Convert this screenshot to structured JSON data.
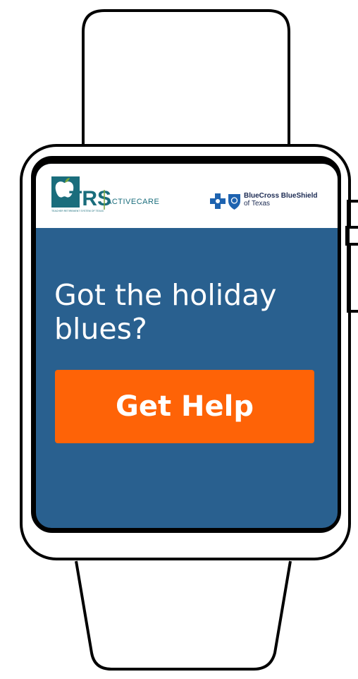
{
  "brand": {
    "trs_initials": "TRS",
    "trs_tagline": "TEACHER RETIREMENT SYSTEM OF TEXAS",
    "program_name": "ACTIVECARE",
    "insurer_name": "BlueCross BlueShield",
    "insurer_region": "of Texas"
  },
  "main": {
    "headline": "Got the holiday blues?",
    "cta_label": "Get Help"
  },
  "colors": {
    "screen_background": "#29608f",
    "cta_background": "#fe6307",
    "trs_teal": "#1a6d7c",
    "trs_green": "#79a73a",
    "bcbs_blue": "#1e63b0"
  },
  "icons": [
    "apple-icon",
    "blue-cross-icon",
    "blue-shield-icon"
  ]
}
